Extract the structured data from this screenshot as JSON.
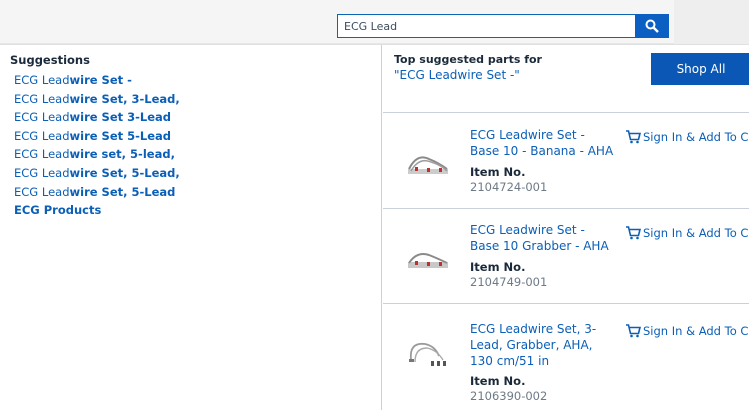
{
  "search": {
    "value": "ECG Lead",
    "placeholder": ""
  },
  "suggestions": {
    "title": "Suggestions",
    "items": [
      {
        "prefix": "ECG Lead",
        "bold": "wire Set -",
        "rest": ""
      },
      {
        "prefix": "ECG Lead",
        "bold": "wire Set, 3-Lead,",
        "rest": ""
      },
      {
        "prefix": "ECG Lead",
        "bold": "wire Set 3-Lead",
        "rest": ""
      },
      {
        "prefix": "ECG Lead",
        "bold": "wire Set 5-Lead",
        "rest": ""
      },
      {
        "prefix": "ECG Lead",
        "bold": "wire set, 5-lead,",
        "rest": ""
      },
      {
        "prefix": "ECG Lead",
        "bold": "wire Set, 5-Lead,",
        "rest": ""
      },
      {
        "prefix": "ECG Lead",
        "bold": "wire Set, 5-Lead",
        "rest": ""
      }
    ],
    "products_label": "ECG Products"
  },
  "top_parts": {
    "title": "Top suggested parts for",
    "query": "\"ECG Leadwire Set -\"",
    "shop_all_label": "Shop All",
    "parts": [
      {
        "name": "ECG Leadwire Set - Base 10 - Banana - AHA",
        "item_no_label": "Item No.",
        "item_no": "2104724-001",
        "cart_label": "Sign In & Add To Cart"
      },
      {
        "name": "ECG Leadwire Set - Base 10 Grabber - AHA",
        "item_no_label": "Item No.",
        "item_no": "2104749-001",
        "cart_label": "Sign In & Add To Cart"
      },
      {
        "name": "ECG Leadwire Set, 3-Lead, Grabber, AHA, 130 cm/51 in",
        "item_no_label": "Item No.",
        "item_no": "2106390-002",
        "cart_label": "Sign In & Add To Cart"
      }
    ]
  },
  "colors": {
    "accent": "#0a57b5",
    "link": "#0b5fb7",
    "divider": "#c9d2dc"
  },
  "icons": {
    "search": "search-icon",
    "cart": "cart-icon"
  }
}
